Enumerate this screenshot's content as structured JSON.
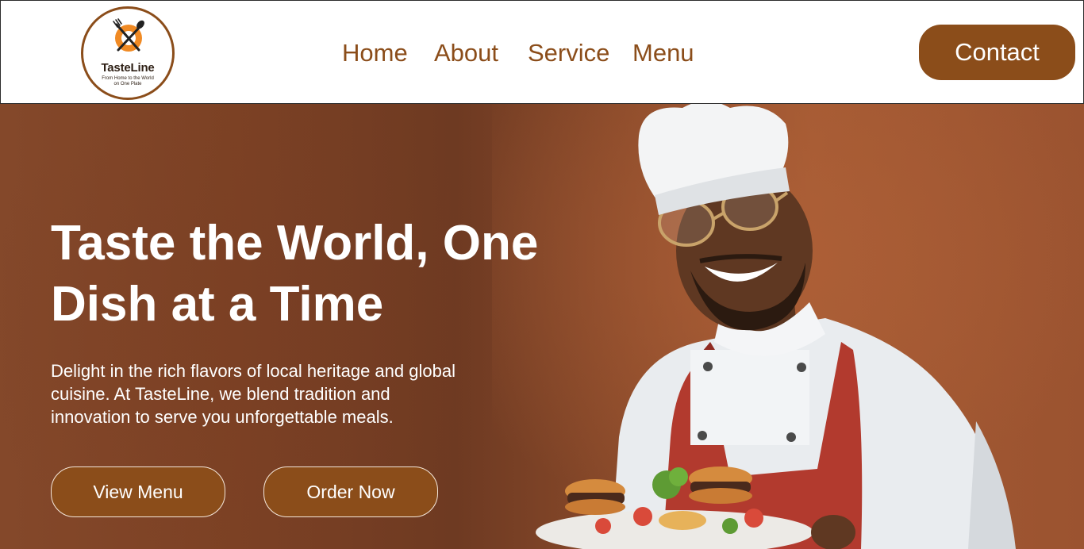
{
  "header": {
    "logo": {
      "name": "TasteLine",
      "tagline_line1": "From Home to the World",
      "tagline_line2": "on One Plate"
    },
    "nav": [
      {
        "label": "Home"
      },
      {
        "label": "About"
      },
      {
        "label": "Service"
      },
      {
        "label": "Menu"
      }
    ],
    "contact_label": "Contact"
  },
  "hero": {
    "title_line1": "Taste the World, One",
    "title_line2": "Dish at a Time",
    "description_line1": "Delight in the rich flavors of local heritage and global",
    "description_line2": "cuisine. At TasteLine, we blend tradition and",
    "description_line3": "innovation to serve you unforgettable meals.",
    "view_menu_label": "View Menu",
    "order_now_label": "Order Now",
    "image": "smiling-chef-holding-burger-plate"
  },
  "colors": {
    "brand_brown": "#8b4d1a",
    "hero_background": "#8a4a2a",
    "logo_orange": "#f08a24",
    "text_white": "#ffffff"
  }
}
